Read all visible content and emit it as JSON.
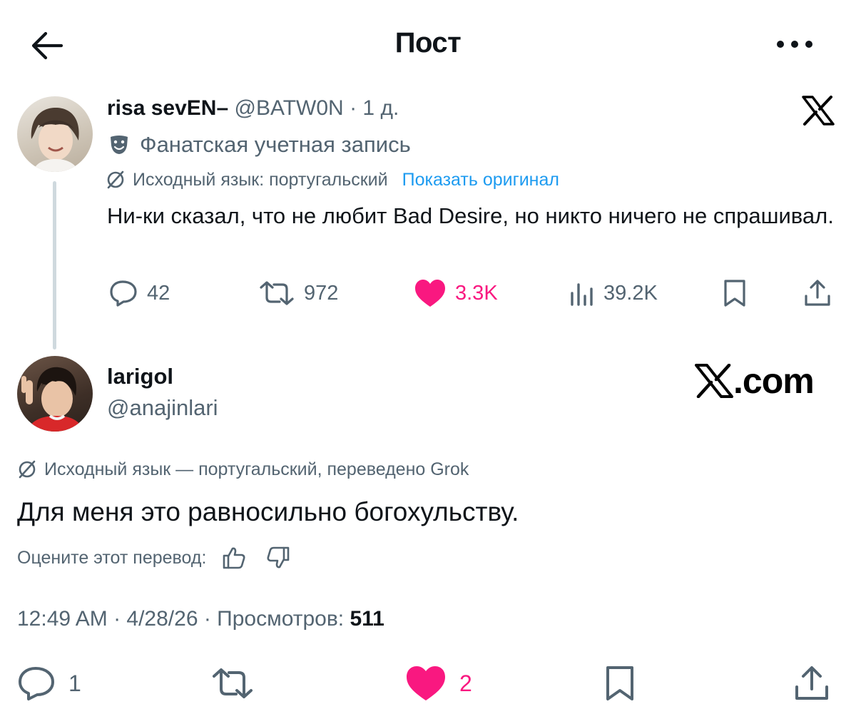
{
  "header": {
    "title": "Пост",
    "back_icon": "arrow-left-icon",
    "more_icon": "more-horizontal-icon"
  },
  "quoted_post": {
    "author_name": "risa sevEN–",
    "handle": "@BATW0N",
    "separator": "·",
    "time": "1 д.",
    "account_label": "Фанатская учетная запись",
    "account_label_icon": "theater-masks-icon",
    "source_language": "Исходный язык: португальский",
    "show_original": "Показать оригинал",
    "text": "Ни-ки сказал, что не любит Bad Desire, но никто ничего не спрашивал.",
    "stats": {
      "replies": "42",
      "reposts": "972",
      "likes": "3.3K",
      "views": "39.2K"
    },
    "like_color": "#f91880"
  },
  "reply_post": {
    "author_name": "larigol",
    "handle": "@anajinlari",
    "watermark": ".com",
    "source_language": "Исходный язык — португальский, переведено Grok",
    "text": "Для меня это равносильно богохульству.",
    "rate_label": "Оцените этот перевод:",
    "meta_prefix": "12:49 AM · 4/28/26 · Просмотров: ",
    "views": "511",
    "stats": {
      "replies": "1",
      "likes": "2"
    }
  },
  "colors": {
    "text": "#0f1419",
    "secondary": "#536471",
    "link": "#1d9bf0",
    "like": "#f91880",
    "thread_line": "#cfd9de"
  }
}
